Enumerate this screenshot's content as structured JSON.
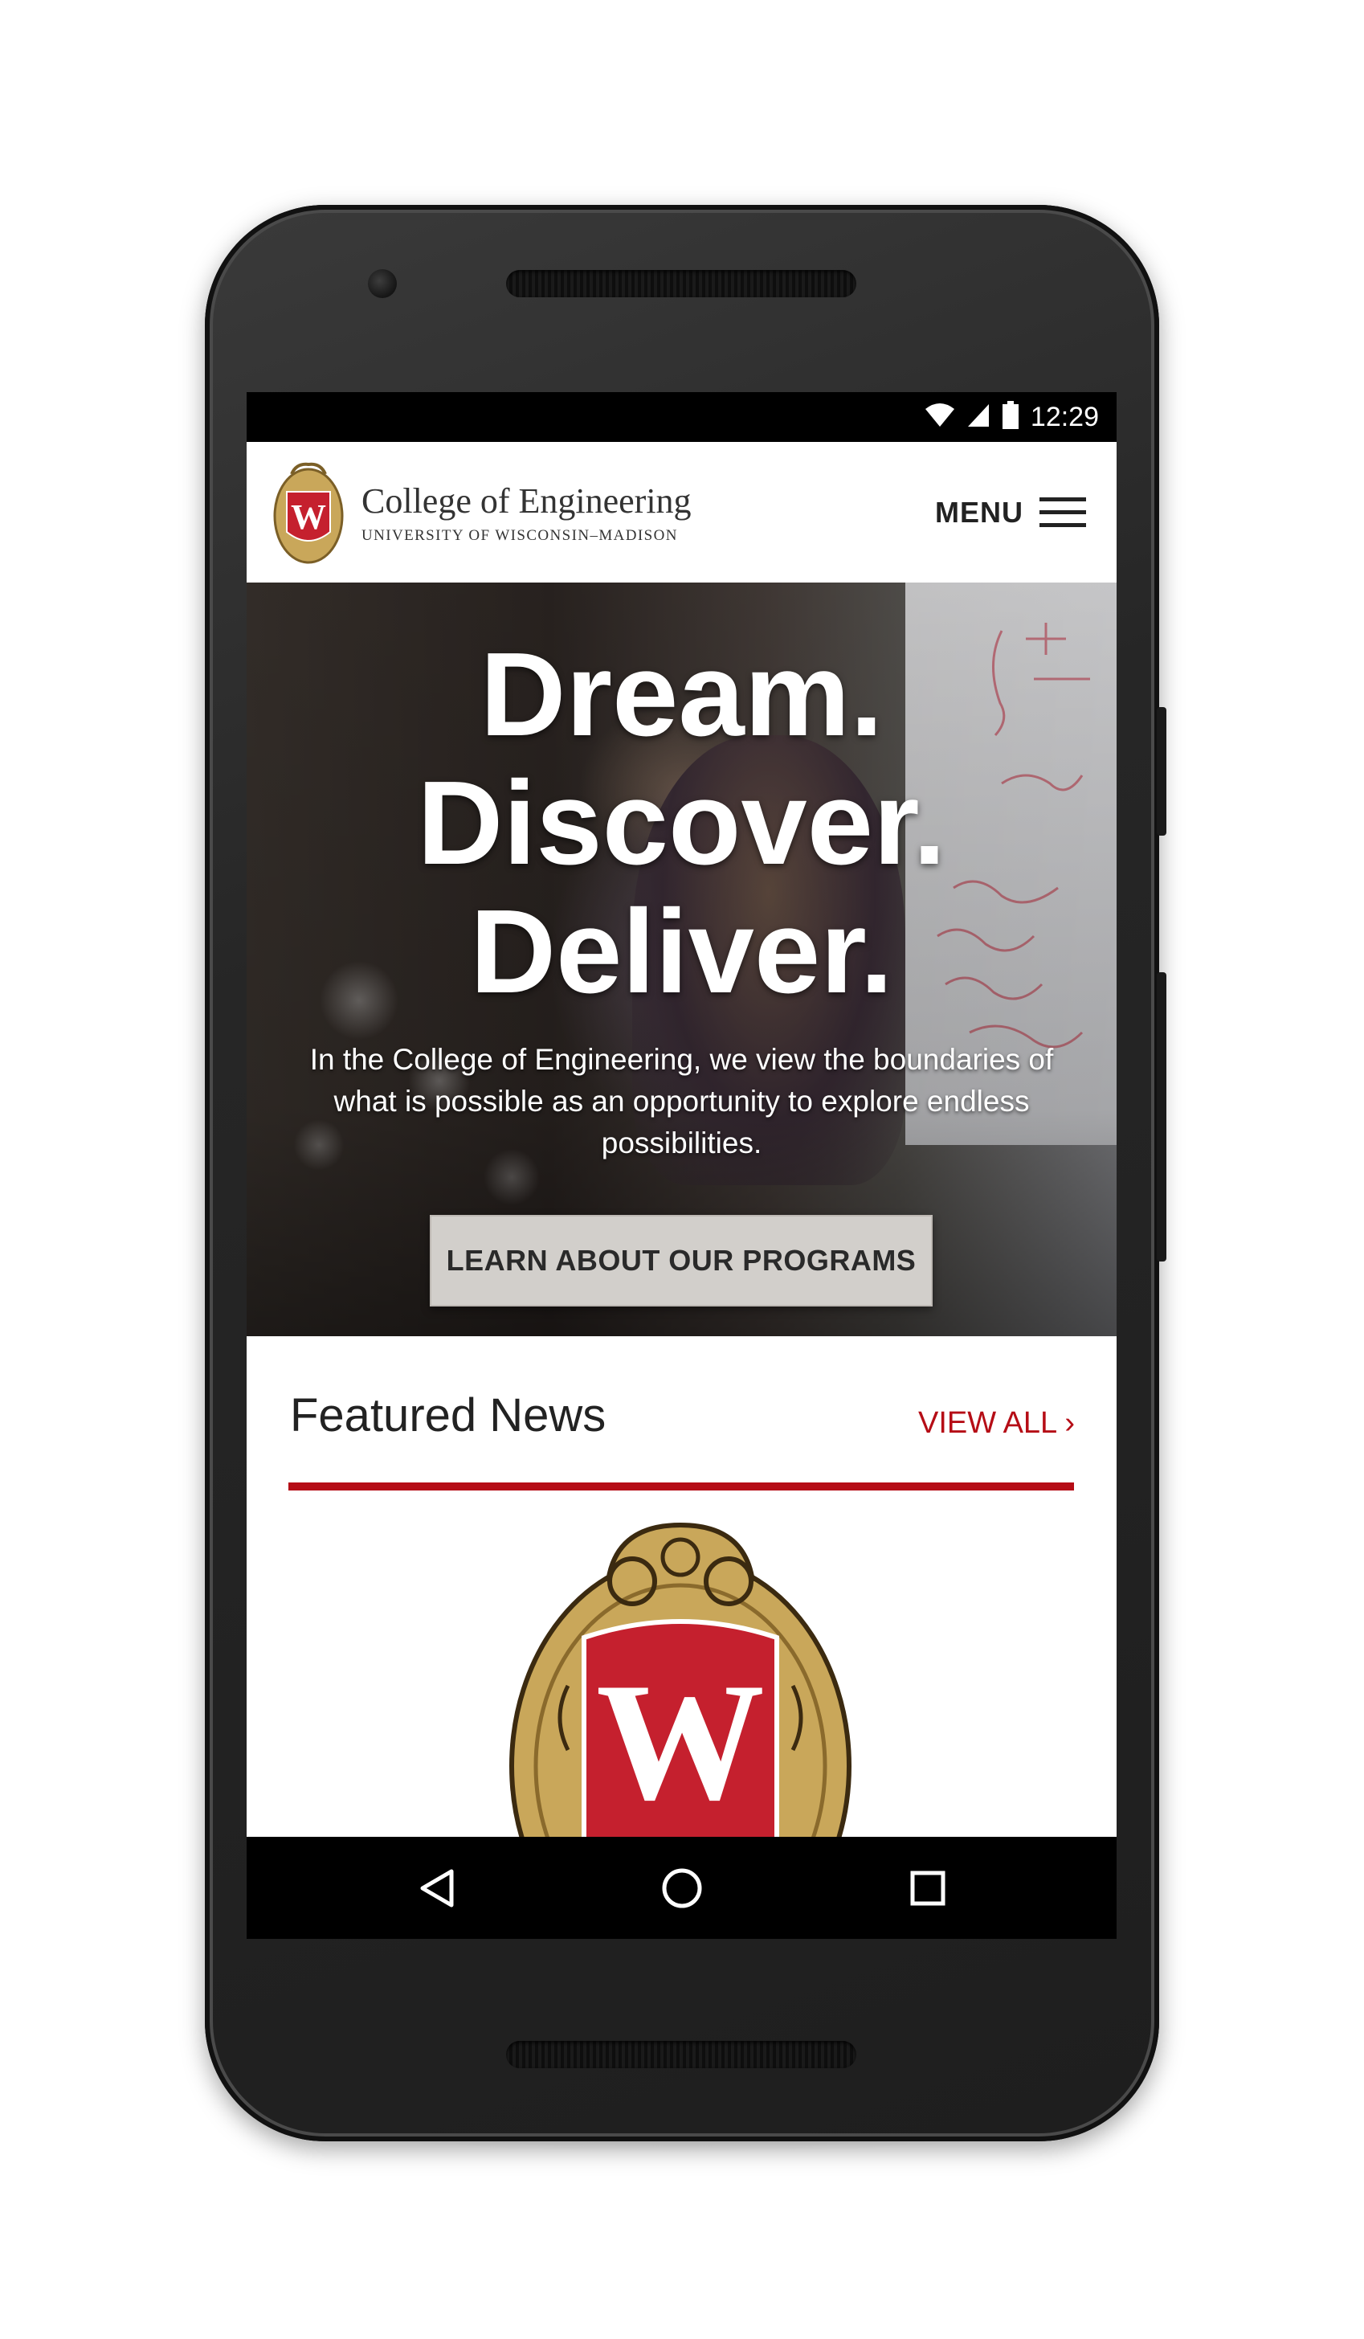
{
  "device": {
    "status_bar": {
      "time": "12:29",
      "icons": [
        "wifi-icon",
        "signal-icon",
        "battery-icon"
      ]
    },
    "nav_bar": {
      "icons": [
        "back-icon",
        "home-icon",
        "recents-icon"
      ]
    }
  },
  "header": {
    "logo_icon": "uw-crest-icon",
    "title": "College of Engineering",
    "subtitle": "UNIVERSITY OF WISCONSIN–MADISON",
    "menu_label": "MENU",
    "menu_icon": "hamburger-icon"
  },
  "hero": {
    "line1": "Dream.",
    "line2": "Discover.",
    "line3": "Deliver.",
    "body": "In the College of Engineering, we view the boundaries of what is possible as an opportunity to explore endless possibilities.",
    "cta_label": "LEARN ABOUT OUR PROGRAMS"
  },
  "featured": {
    "title": "Featured News",
    "view_all": "VIEW ALL ›",
    "image_icon": "uw-crest-icon"
  },
  "colors": {
    "brand_red": "#b50d16",
    "crest_gold": "#c9a75a",
    "crest_red": "#c5202e"
  }
}
